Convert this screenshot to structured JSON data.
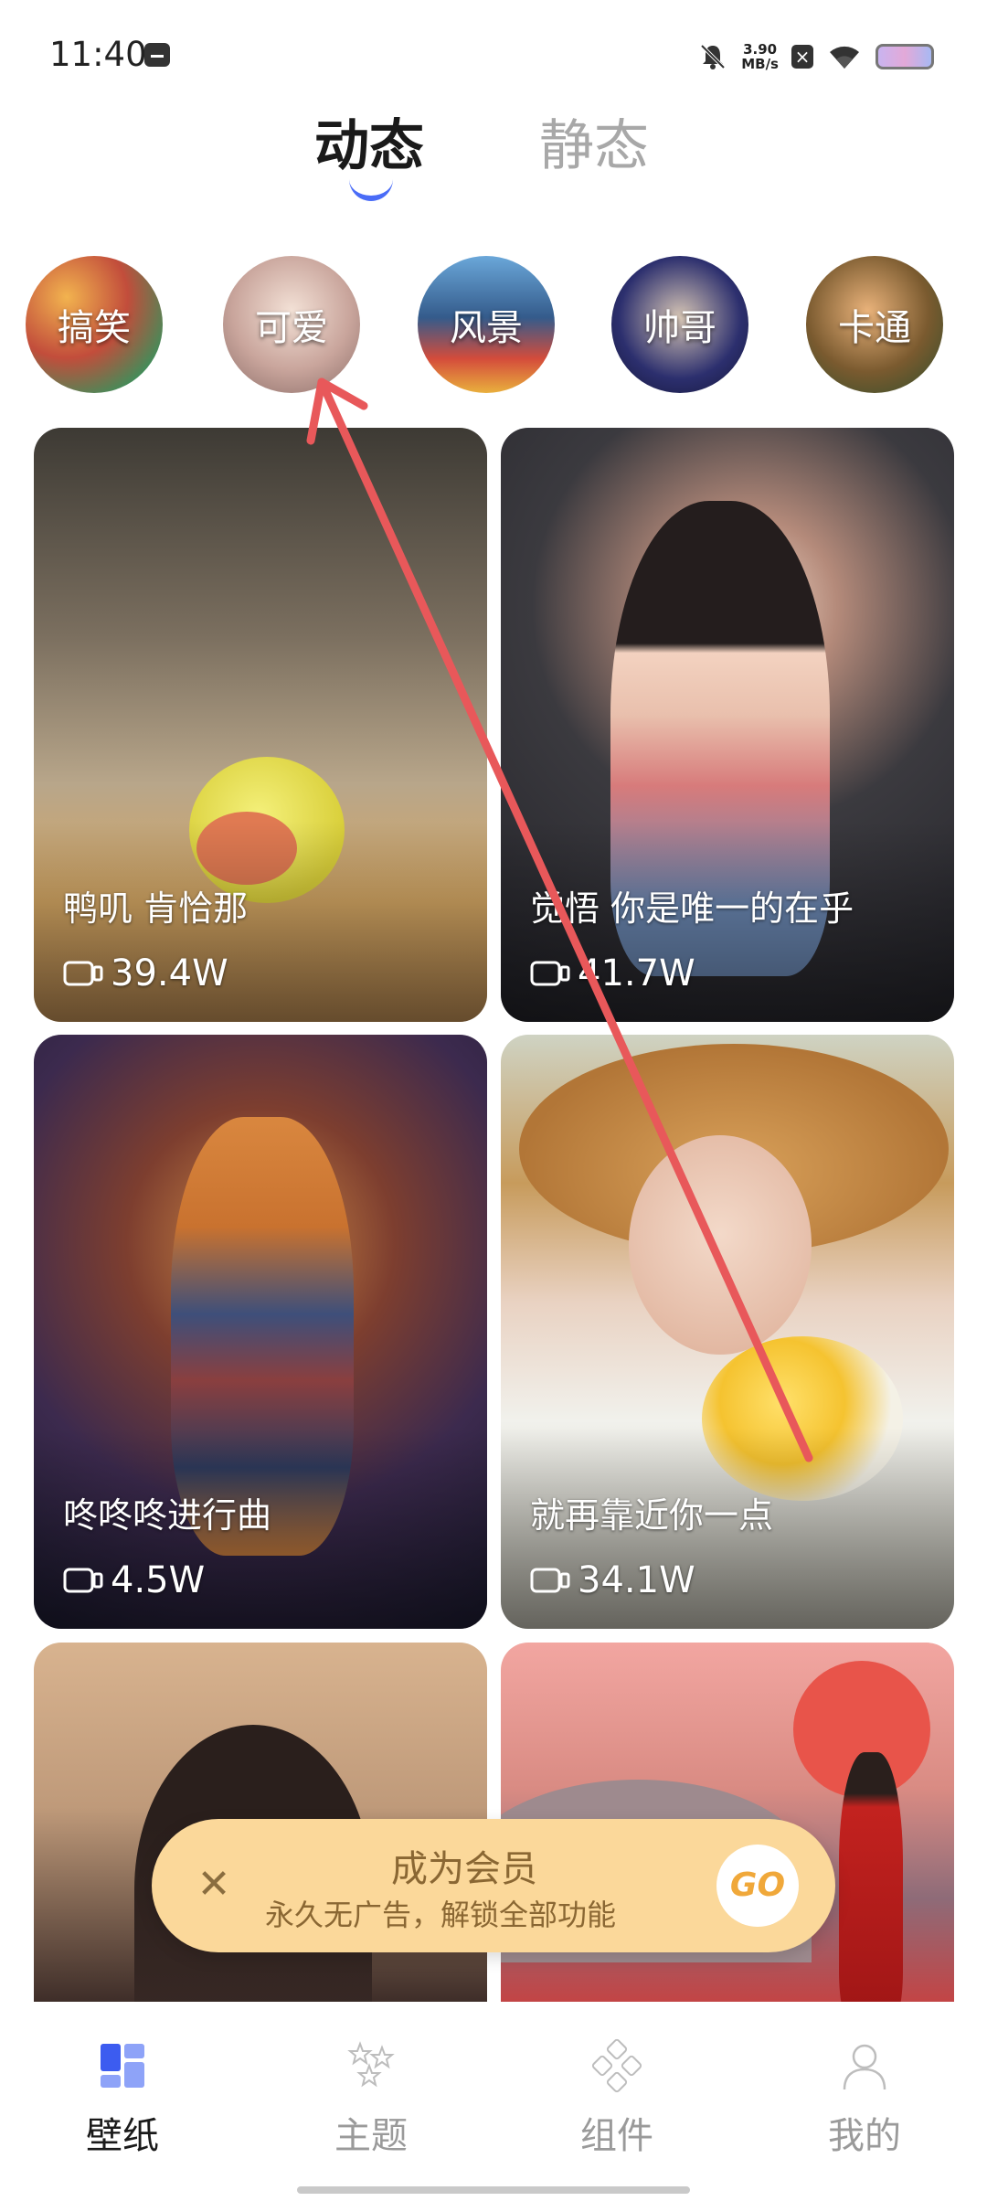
{
  "status_bar": {
    "time": "11:40",
    "net_speed_value": "3.90",
    "net_speed_unit": "MB/s"
  },
  "tabs": [
    {
      "label": "动态",
      "active": true
    },
    {
      "label": "静态",
      "active": false
    }
  ],
  "categories": [
    {
      "label": "搞笑"
    },
    {
      "label": "可爱"
    },
    {
      "label": "风景"
    },
    {
      "label": "帅哥"
    },
    {
      "label": "卡通"
    }
  ],
  "cards": [
    {
      "title": "鸭叽 肯恰那",
      "views": "39.4W"
    },
    {
      "title": "觉悟 你是唯一的在乎",
      "views": "41.7W"
    },
    {
      "title": "咚咚咚进行曲",
      "views": "4.5W"
    },
    {
      "title": "就再靠近你一点",
      "views": "34.1W"
    }
  ],
  "vip_banner": {
    "title": "成为会员",
    "subtitle": "永久无广告，解锁全部功能",
    "go_label": "GO",
    "close_glyph": "✕"
  },
  "bottom_nav": [
    {
      "label": "壁纸",
      "active": true
    },
    {
      "label": "主题",
      "active": false
    },
    {
      "label": "组件",
      "active": false
    },
    {
      "label": "我的",
      "active": false
    }
  ],
  "colors": {
    "accent": "#4a6cf7",
    "annotation_arrow": "#e8585a",
    "vip_banner_bg": "#fbd89a",
    "vip_text": "#8a6733"
  }
}
